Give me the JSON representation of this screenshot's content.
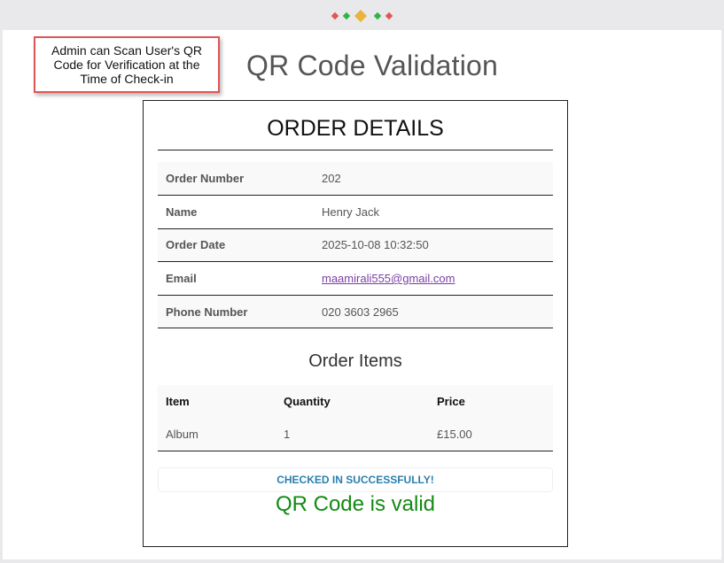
{
  "callout": {
    "text": "Admin can Scan User's QR Code for Verification at the Time of Check-in",
    "border_color": "#e05555"
  },
  "page": {
    "title": "QR Code Validation"
  },
  "order": {
    "heading": "ORDER DETAILS",
    "rows": [
      {
        "label": "Order Number",
        "value": "202"
      },
      {
        "label": "Name",
        "value": "Henry Jack"
      },
      {
        "label": "Order Date",
        "value": "2025-10-08 10:32:50"
      },
      {
        "label": "Email",
        "value": "maamirali555@gmail.com"
      },
      {
        "label": "Phone Number",
        "value": "020 3603 2965"
      }
    ]
  },
  "items": {
    "heading": "Order Items",
    "columns": [
      "Item",
      "Quantity",
      "Price"
    ],
    "rows": [
      {
        "item": "Album",
        "quantity": "1",
        "price": "£15.00"
      }
    ]
  },
  "status": {
    "message": "CHECKED IN SUCCESSFULLY!",
    "valid_text": "QR Code is valid",
    "message_color": "#2a7fae",
    "valid_color": "#138a13"
  },
  "icons": {
    "loader": "loading-dots-icon"
  }
}
